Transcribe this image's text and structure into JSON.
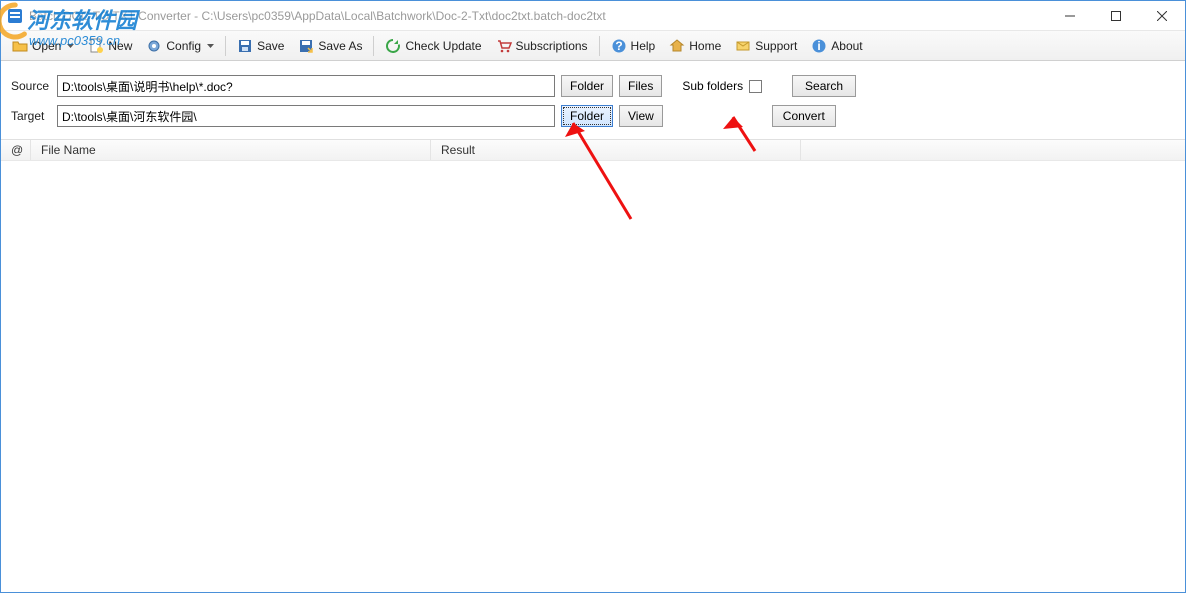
{
  "window": {
    "title": "Batch DOC TO TXT Converter - C:\\Users\\pc0359\\AppData\\Local\\Batchwork\\Doc-2-Txt\\doc2txt.batch-doc2txt"
  },
  "toolbar": {
    "open": "Open",
    "new": "New",
    "config": "Config",
    "save": "Save",
    "save_as": "Save As",
    "check_update": "Check Update",
    "subscriptions": "Subscriptions",
    "help": "Help",
    "home": "Home",
    "support": "Support",
    "about": "About"
  },
  "form": {
    "source_label": "Source",
    "source_value": "D:\\tools\\桌面\\说明书\\help\\*.doc?",
    "target_label": "Target",
    "target_value": "D:\\tools\\桌面\\河东软件园\\",
    "folder_btn": "Folder",
    "files_btn": "Files",
    "view_btn": "View",
    "sub_folders_label": "Sub folders",
    "search_btn": "Search",
    "convert_btn": "Convert"
  },
  "columns": {
    "at": "@",
    "filename": "File Name",
    "result": "Result"
  },
  "watermark": {
    "line1": "河东软件园",
    "line2": "www.pc0359.cn"
  }
}
